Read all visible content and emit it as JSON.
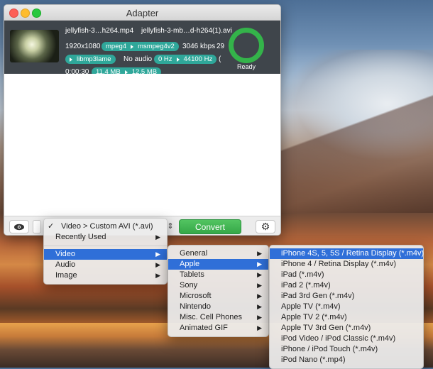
{
  "window": {
    "title": "Adapter"
  },
  "item": {
    "source_name": "jellyfish-3…h264.mp4",
    "output_name": "jellyfish-3-mb…d-h264(1).avi",
    "resolution": "1920x1080",
    "video_codec_from": "mpeg4",
    "video_codec_to": "msmpeg4v2",
    "bitrate": "3046 kbps",
    "truncated_right": "29",
    "audio_codec": "libmp3lame",
    "no_audio": "No audio",
    "sample_from": "0 Hz",
    "sample_to": "44100 Hz",
    "truncated_right2": "(",
    "duration": "0:00:30",
    "size_from": "11.4 MB",
    "size_to": "12.5 MB",
    "status": "Ready"
  },
  "toolbar": {
    "convert_label": "Convert"
  },
  "menu1": {
    "items": [
      {
        "label": "Video > Custom AVI (*.avi)",
        "checked": true
      },
      {
        "label": "Recently Used"
      },
      {
        "label": "Video"
      },
      {
        "label": "Audio"
      },
      {
        "label": "Image"
      }
    ]
  },
  "menu2": {
    "items": [
      "General",
      "Apple",
      "Tablets",
      "Sony",
      "Microsoft",
      "Nintendo",
      "Misc. Cell Phones",
      "Animated GIF"
    ]
  },
  "menu3": {
    "items": [
      "iPhone 4S, 5, 5S / Retina Display (*.m4v)",
      "iPhone 4 / Retina Display (*.m4v)",
      "iPad (*.m4v)",
      "iPad 2 (*.m4v)",
      "iPad 3rd Gen (*.m4v)",
      "Apple TV (*.m4v)",
      "Apple TV 2 (*.m4v)",
      "Apple TV 3rd Gen (*.m4v)",
      "iPod Video / iPod Classic (*.m4v)",
      "iPhone / iPod Touch (*.m4v)",
      "iPod Nano (*.mp4)"
    ]
  },
  "glyphs": {
    "check": "✓",
    "submenu": "▶",
    "eye": "👁",
    "gear": "⚙",
    "updown": "⇕"
  }
}
